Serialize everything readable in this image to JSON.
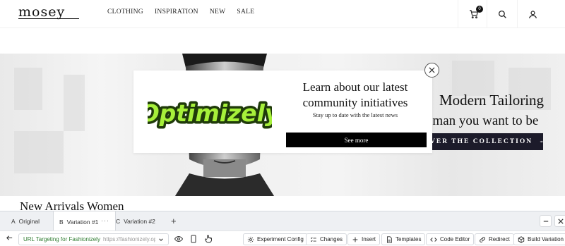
{
  "site": {
    "logo": "mosey",
    "nav": [
      "CLOTHING",
      "INSPIRATION",
      "NEW",
      "SALE"
    ],
    "cart_count": "0"
  },
  "hero": {
    "heading": "Modern Tailoring",
    "subheading": "eman you want to be",
    "cta": "VER THE COLLECTION"
  },
  "modal": {
    "brand_text": "Optimizely",
    "title": "Learn about our latest community initiatives",
    "subtitle": "Stay up to date with the latest news",
    "button": "See more"
  },
  "section": {
    "title": "New Arrivals Women"
  },
  "editor": {
    "tabs": [
      {
        "letter": "A",
        "label": "Original"
      },
      {
        "letter": "B",
        "label": "Variation #1"
      },
      {
        "letter": "C",
        "label": "Variation #2"
      }
    ],
    "tab_more": "···",
    "url_targeting": {
      "name": "URL Targeting for Fashionizely",
      "url": "https://fashionizely.opti..."
    },
    "toolbar": [
      {
        "label": "Experiment Config",
        "icon": "gear-icon"
      },
      {
        "label": "Changes",
        "icon": "list-icon"
      },
      {
        "label": "Insert",
        "icon": "plus-icon"
      },
      {
        "label": "Templates",
        "icon": "document-icon"
      },
      {
        "label": "Code Editor",
        "icon": "code-icon"
      },
      {
        "label": "Redirect",
        "icon": "link-icon"
      },
      {
        "label": "Build Variation",
        "icon": "cube-icon"
      }
    ]
  },
  "colors": {
    "brand_green": "#a6f03a",
    "cta_bg": "#1c1b2a",
    "url_green": "#2f7d32"
  }
}
